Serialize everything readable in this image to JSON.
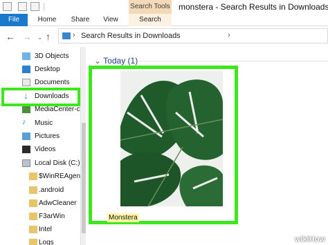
{
  "window": {
    "title": "monstera - Search Results in Downloads",
    "contextual_tab_group": "Search Tools"
  },
  "ribbon": {
    "tabs": [
      {
        "label": "File"
      },
      {
        "label": "Home"
      },
      {
        "label": "Share"
      },
      {
        "label": "View"
      },
      {
        "label": "Search"
      }
    ]
  },
  "address": {
    "path": "Search Results in Downloads",
    "back_icon": "back-arrow-icon",
    "forward_icon": "forward-arrow-icon",
    "up_icon": "up-arrow-icon"
  },
  "nav": {
    "items": [
      {
        "label": "3D Objects",
        "icon": "3d-objects-icon"
      },
      {
        "label": "Desktop",
        "icon": "desktop-icon"
      },
      {
        "label": "Documents",
        "icon": "documents-icon"
      },
      {
        "label": "Downloads",
        "icon": "download-arrow-icon"
      },
      {
        "label": "MediaCenter-c",
        "icon": "media-icon"
      },
      {
        "label": "Music",
        "icon": "music-icon"
      },
      {
        "label": "Pictures",
        "icon": "pictures-icon"
      },
      {
        "label": "Videos",
        "icon": "videos-icon"
      },
      {
        "label": "Local Disk (C:)",
        "icon": "drive-icon"
      },
      {
        "label": "$WinREAgent",
        "icon": "folder-icon"
      },
      {
        "label": ".android",
        "icon": "folder-icon"
      },
      {
        "label": "AdwCleaner",
        "icon": "folder-icon"
      },
      {
        "label": "F3arWin",
        "icon": "folder-icon"
      },
      {
        "label": "Intel",
        "icon": "folder-icon"
      },
      {
        "label": "Logs",
        "icon": "folder-icon"
      }
    ]
  },
  "content": {
    "group_header": "Today (1)",
    "file_name": "Monstera"
  },
  "watermark": "wikiHow",
  "colors": {
    "highlight": "#3ce81c",
    "file_tab": "#1979ca",
    "search_tools": "#f3d9b7"
  }
}
